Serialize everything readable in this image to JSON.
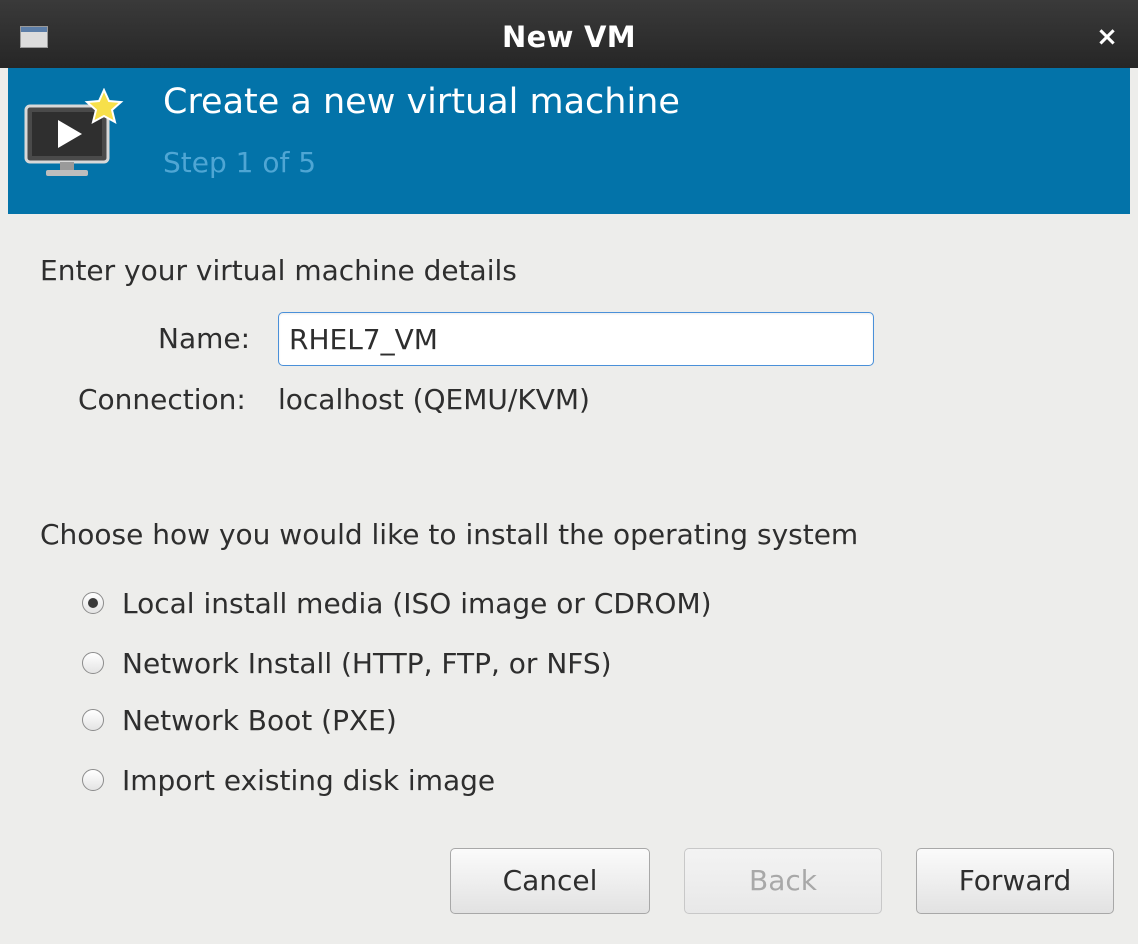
{
  "titlebar": {
    "title": "New VM",
    "close_glyph": "×",
    "icon": "window-icon"
  },
  "banner": {
    "heading": "Create a new virtual machine",
    "step": "Step 1 of 5",
    "icon": "monitor-play-star-icon",
    "bg_color": "#0373a9"
  },
  "details": {
    "section_label": "Enter your virtual machine details",
    "name_label": "Name:",
    "name_value": "RHEL7_VM",
    "connection_label": "Connection:",
    "connection_value": "localhost (QEMU/KVM)"
  },
  "install": {
    "section_label": "Choose how you would like to install the operating system",
    "options": [
      {
        "label": "Local install media (ISO image or CDROM)",
        "checked": true
      },
      {
        "label": "Network Install (HTTP, FTP, or NFS)",
        "checked": false
      },
      {
        "label": "Network Boot (PXE)",
        "checked": false
      },
      {
        "label": "Import existing disk image",
        "checked": false
      }
    ]
  },
  "buttons": {
    "cancel": "Cancel",
    "back": "Back",
    "forward": "Forward",
    "back_enabled": false
  }
}
